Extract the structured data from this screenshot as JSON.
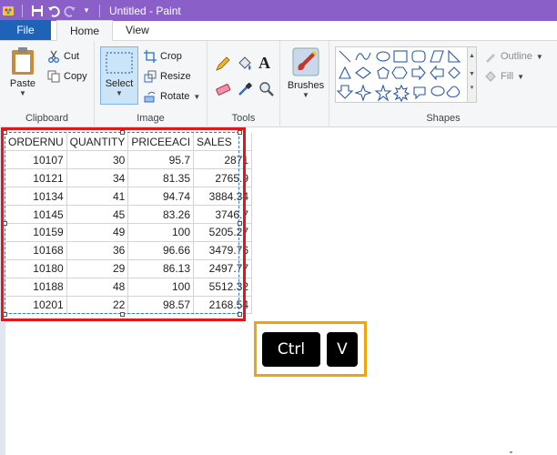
{
  "window": {
    "title": "Untitled - Paint"
  },
  "tabs": [
    {
      "label": "File"
    },
    {
      "label": "Home"
    },
    {
      "label": "View"
    }
  ],
  "ribbon": {
    "clipboard": {
      "label": "Clipboard",
      "paste": "Paste",
      "cut": "Cut",
      "copy": "Copy"
    },
    "image": {
      "label": "Image",
      "select": "Select",
      "crop": "Crop",
      "resize": "Resize",
      "rotate": "Rotate"
    },
    "tools": {
      "label": "Tools"
    },
    "brushes": {
      "label": "Brushes"
    },
    "shapes": {
      "label": "Shapes",
      "outline": "Outline",
      "fill": "Fill"
    }
  },
  "table": {
    "headers": [
      "ORDERNU",
      "QUANTITY",
      "PRICEEACI",
      "SALES"
    ],
    "rows": [
      [
        "10107",
        "30",
        "95.7",
        "2871"
      ],
      [
        "10121",
        "34",
        "81.35",
        "2765.9"
      ],
      [
        "10134",
        "41",
        "94.74",
        "3884.34"
      ],
      [
        "10145",
        "45",
        "83.26",
        "3746.7"
      ],
      [
        "10159",
        "49",
        "100",
        "5205.27"
      ],
      [
        "10168",
        "36",
        "96.66",
        "3479.76"
      ],
      [
        "10180",
        "29",
        "86.13",
        "2497.77"
      ],
      [
        "10188",
        "48",
        "100",
        "5512.32"
      ],
      [
        "10201",
        "22",
        "98.57",
        "2168.54"
      ]
    ]
  },
  "shortcut": {
    "key1": "Ctrl",
    "key2": "V"
  },
  "colors": {
    "titlebar": "#8a5fc7",
    "file_tab": "#1e63b8",
    "selection_border": "#e3161b",
    "shortcut_border": "#f0a30a"
  }
}
